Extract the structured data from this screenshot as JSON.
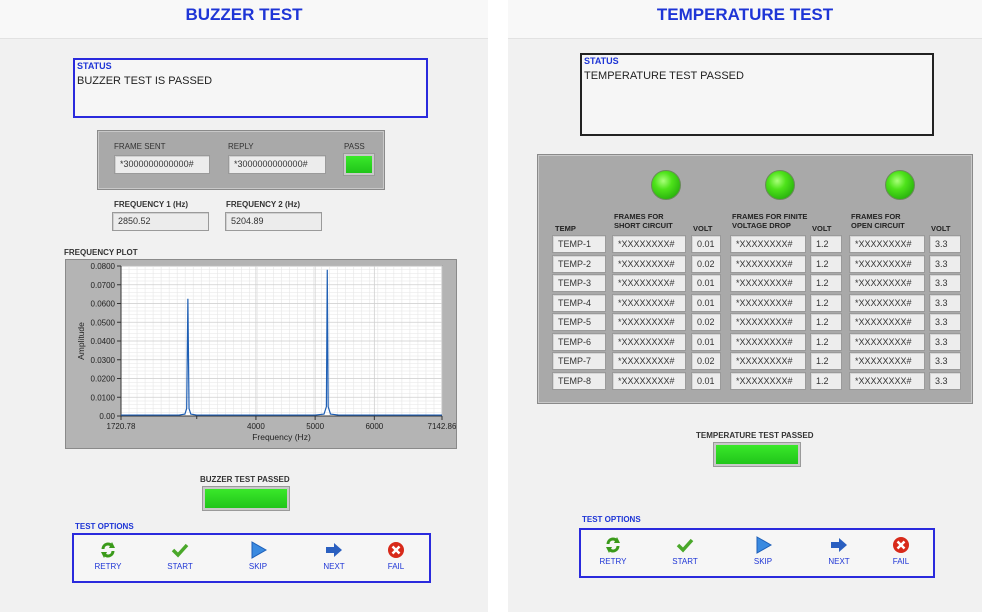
{
  "left": {
    "title": "BUZZER TEST",
    "status": {
      "label": "STATUS",
      "text": "BUZZER TEST IS PASSED"
    },
    "frame": {
      "sent_label": "FRAME SENT",
      "sent_value": "*3000000000000#",
      "reply_label": "REPLY",
      "reply_value": "*3000000000000#",
      "pass_label": "PASS"
    },
    "freq1": {
      "label": "FREQUENCY 1 (Hz)",
      "value": "2850.52"
    },
    "freq2": {
      "label": "FREQUENCY 2 (Hz)",
      "value": "5204.89"
    },
    "plot_label": "FREQUENCY PLOT",
    "result_label": "BUZZER TEST PASSED",
    "options_label": "TEST OPTIONS"
  },
  "right": {
    "title": "TEMPERATURE TEST",
    "status": {
      "label": "STATUS",
      "text": "TEMPERATURE TEST PASSED"
    },
    "headers": {
      "temp": "TEMP",
      "short": "FRAMES FOR SHORT CIRCUIT",
      "volt": "VOLT",
      "finite": "FRAMES FOR FINITE VOLTAGE DROP",
      "open": "FRAMES FOR OPEN CIRCUIT"
    },
    "rows": [
      {
        "temp": "TEMP-1",
        "short": "*XXXXXXXX#",
        "v1": "0.01",
        "finite": "*XXXXXXXX#",
        "v2": "1.2",
        "open": "*XXXXXXXX#",
        "v3": "3.3"
      },
      {
        "temp": "TEMP-2",
        "short": "*XXXXXXXX#",
        "v1": "0.02",
        "finite": "*XXXXXXXX#",
        "v2": "1.2",
        "open": "*XXXXXXXX#",
        "v3": "3.3"
      },
      {
        "temp": "TEMP-3",
        "short": "*XXXXXXXX#",
        "v1": "0.01",
        "finite": "*XXXXXXXX#",
        "v2": "1.2",
        "open": "*XXXXXXXX#",
        "v3": "3.3"
      },
      {
        "temp": "TEMP-4",
        "short": "*XXXXXXXX#",
        "v1": "0.01",
        "finite": "*XXXXXXXX#",
        "v2": "1.2",
        "open": "*XXXXXXXX#",
        "v3": "3.3"
      },
      {
        "temp": "TEMP-5",
        "short": "*XXXXXXXX#",
        "v1": "0.02",
        "finite": "*XXXXXXXX#",
        "v2": "1.2",
        "open": "*XXXXXXXX#",
        "v3": "3.3"
      },
      {
        "temp": "TEMP-6",
        "short": "*XXXXXXXX#",
        "v1": "0.01",
        "finite": "*XXXXXXXX#",
        "v2": "1.2",
        "open": "*XXXXXXXX#",
        "v3": "3.3"
      },
      {
        "temp": "TEMP-7",
        "short": "*XXXXXXXX#",
        "v1": "0.02",
        "finite": "*XXXXXXXX#",
        "v2": "1.2",
        "open": "*XXXXXXXX#",
        "v3": "3.3"
      },
      {
        "temp": "TEMP-8",
        "short": "*XXXXXXXX#",
        "v1": "0.01",
        "finite": "*XXXXXXXX#",
        "v2": "1.2",
        "open": "*XXXXXXXX#",
        "v3": "3.3"
      }
    ],
    "result_label": "TEMPERATURE TEST PASSED",
    "options_label": "TEST OPTIONS"
  },
  "test_options": [
    {
      "label": "RETRY",
      "icon": "retry-icon"
    },
    {
      "label": "START",
      "icon": "checkmark-icon"
    },
    {
      "label": "SKIP",
      "icon": "play-icon"
    },
    {
      "label": "NEXT",
      "icon": "right-arrow-icon"
    },
    {
      "label": "FAIL",
      "icon": "fail-icon"
    }
  ],
  "colors": {
    "accent_blue": "#1e35d6",
    "pass_green": "#2bd81a",
    "plot_line": "#1f5fb4"
  },
  "chart_data": {
    "type": "line",
    "title": "",
    "xlabel": "Frequency (Hz)",
    "ylabel": "Amplitude",
    "xlim": [
      1720.78,
      7142.86
    ],
    "ylim": [
      0,
      0.08
    ],
    "xticks": [
      "1720.78",
      "4000",
      "5000",
      "6000",
      "7142.86"
    ],
    "yticks": [
      "0.00",
      "0.0100",
      "0.0200",
      "0.0300",
      "0.0400",
      "0.0500",
      "0.0600",
      "0.0700",
      "0.0800"
    ],
    "x_minor_ticks": [
      3000
    ],
    "grid": true,
    "series": [
      {
        "x": [
          1720.78,
          2700,
          2800,
          2830,
          2850.52,
          2870,
          2900,
          3000,
          4000,
          5000,
          5150,
          5190,
          5204.89,
          5220,
          5260,
          5400,
          6000,
          7142.86
        ],
        "y": [
          0.0005,
          0.0005,
          0.001,
          0.004,
          0.0625,
          0.004,
          0.001,
          0.0005,
          0.0005,
          0.0005,
          0.001,
          0.005,
          0.078,
          0.005,
          0.001,
          0.0005,
          0.0005,
          0.0005
        ]
      }
    ]
  }
}
